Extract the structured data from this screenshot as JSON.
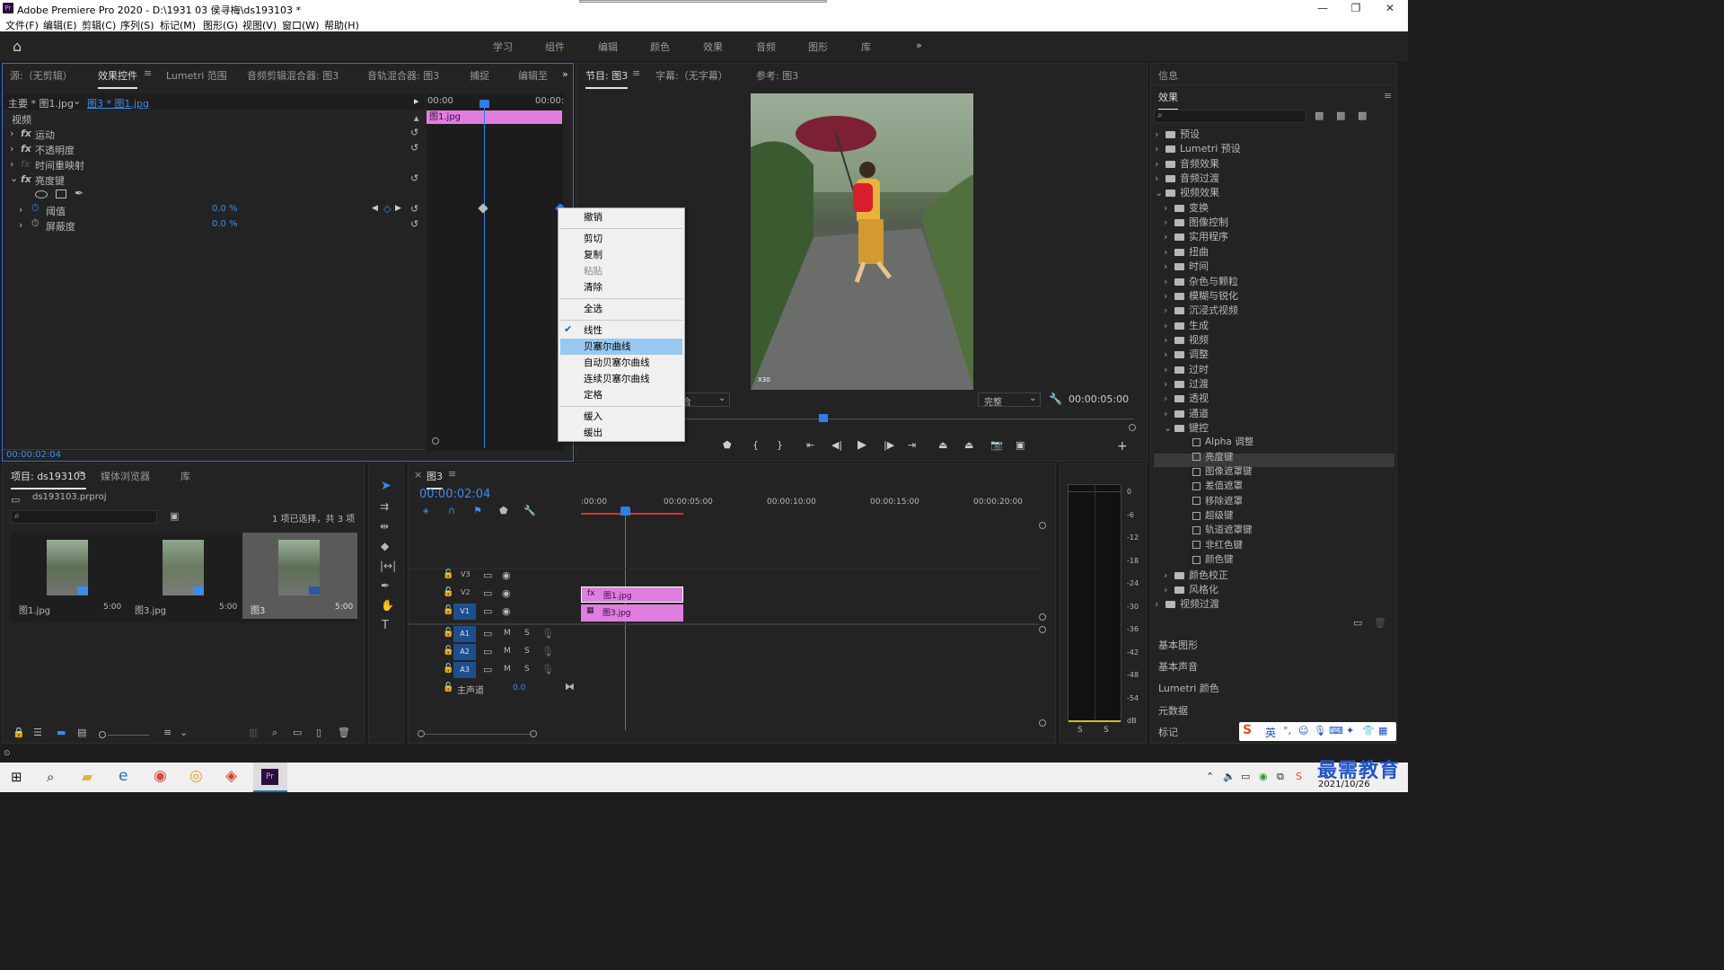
{
  "window": {
    "app_title": "Adobe Premiere Pro 2020 - D:\\1931 03 侯寻梅\\ds193103 *",
    "app_icon": "Pr"
  },
  "menu": [
    "文件(F)",
    "编辑(E)",
    "剪辑(C)",
    "序列(S)",
    "标记(M)",
    "图形(G)",
    "视图(V)",
    "窗口(W)",
    "帮助(H)"
  ],
  "workspaces": [
    "学习",
    "组件",
    "编辑",
    "颜色",
    "效果",
    "音频",
    "图形",
    "库"
  ],
  "source_panel": {
    "tabs": [
      "源:（无剪辑）",
      "效果控件",
      "Lumetri 范围",
      "音频剪辑混合器: 图3",
      "音轨混合器: 图3",
      "捕捉",
      "编辑至"
    ],
    "master": "主要 * 图1.jpg",
    "clip": "图3 * 图1.jpg",
    "section": "视频",
    "effects": [
      "运动",
      "不透明度",
      "时间重映射",
      "亮度键"
    ],
    "params": [
      {
        "name": "阈值",
        "value": "0.0 %"
      },
      {
        "name": "屏蔽度",
        "value": "0.0 %"
      }
    ],
    "mini_time_start": "00:00",
    "mini_time_end": "00:00:",
    "mini_clip": "图1.jpg",
    "timecode": "00:00:02:04"
  },
  "context_menu": {
    "items": [
      {
        "label": "撤销",
        "state": "normal"
      },
      {
        "label": "剪切",
        "state": "normal"
      },
      {
        "label": "复制",
        "state": "normal"
      },
      {
        "label": "粘贴",
        "state": "disabled"
      },
      {
        "label": "清除",
        "state": "normal"
      },
      {
        "label": "全选",
        "state": "normal"
      },
      {
        "label": "线性",
        "state": "checked"
      },
      {
        "label": "贝塞尔曲线",
        "state": "highlighted"
      },
      {
        "label": "自动贝塞尔曲线",
        "state": "normal"
      },
      {
        "label": "连续贝塞尔曲线",
        "state": "normal"
      },
      {
        "label": "定格",
        "state": "normal"
      },
      {
        "label": "缓入",
        "state": "normal"
      },
      {
        "label": "缓出",
        "state": "normal"
      }
    ]
  },
  "program_panel": {
    "tabs": [
      "节目: 图3",
      "字幕:（无字幕）",
      "参考: 图3"
    ],
    "fit_label": "合",
    "quality": "完整",
    "timecode": "00:00:05:00",
    "watermark": "X30"
  },
  "right_panel": {
    "info_label": "信息",
    "effects_label": "效果",
    "tree": [
      {
        "label": "预设",
        "type": "folder",
        "level": 0,
        "open": false
      },
      {
        "label": "Lumetri 预设",
        "type": "folder",
        "level": 0,
        "open": false
      },
      {
        "label": "音频效果",
        "type": "folder",
        "level": 0,
        "open": false
      },
      {
        "label": "音频过渡",
        "type": "folder",
        "level": 0,
        "open": false
      },
      {
        "label": "视频效果",
        "type": "folder",
        "level": 0,
        "open": true
      },
      {
        "label": "变换",
        "type": "folder",
        "level": 1,
        "open": false
      },
      {
        "label": "图像控制",
        "type": "folder",
        "level": 1,
        "open": false
      },
      {
        "label": "实用程序",
        "type": "folder",
        "level": 1,
        "open": false
      },
      {
        "label": "扭曲",
        "type": "folder",
        "level": 1,
        "open": false
      },
      {
        "label": "时间",
        "type": "folder",
        "level": 1,
        "open": false
      },
      {
        "label": "杂色与颗粒",
        "type": "folder",
        "level": 1,
        "open": false
      },
      {
        "label": "模糊与锐化",
        "type": "folder",
        "level": 1,
        "open": false
      },
      {
        "label": "沉浸式视频",
        "type": "folder",
        "level": 1,
        "open": false
      },
      {
        "label": "生成",
        "type": "folder",
        "level": 1,
        "open": false
      },
      {
        "label": "视频",
        "type": "folder",
        "level": 1,
        "open": false
      },
      {
        "label": "调整",
        "type": "folder",
        "level": 1,
        "open": false
      },
      {
        "label": "过时",
        "type": "folder",
        "level": 1,
        "open": false
      },
      {
        "label": "过渡",
        "type": "folder",
        "level": 1,
        "open": false
      },
      {
        "label": "透视",
        "type": "folder",
        "level": 1,
        "open": false
      },
      {
        "label": "通道",
        "type": "folder",
        "level": 1,
        "open": false
      },
      {
        "label": "键控",
        "type": "folder",
        "level": 1,
        "open": true
      },
      {
        "label": "Alpha 调整",
        "type": "preset",
        "level": 2
      },
      {
        "label": "亮度键",
        "type": "preset",
        "level": 2,
        "selected": true
      },
      {
        "label": "图像遮罩键",
        "type": "preset",
        "level": 2
      },
      {
        "label": "差值遮罩",
        "type": "preset",
        "level": 2
      },
      {
        "label": "移除遮罩",
        "type": "preset",
        "level": 2
      },
      {
        "label": "超级键",
        "type": "preset",
        "level": 2
      },
      {
        "label": "轨道遮罩键",
        "type": "preset",
        "level": 2
      },
      {
        "label": "非红色键",
        "type": "preset",
        "level": 2
      },
      {
        "label": "颜色键",
        "type": "preset",
        "level": 2
      },
      {
        "label": "颜色校正",
        "type": "folder",
        "level": 1,
        "open": false
      },
      {
        "label": "风格化",
        "type": "folder",
        "level": 1,
        "open": false
      },
      {
        "label": "视频过渡",
        "type": "folder",
        "level": 0,
        "open": false
      }
    ],
    "bottom_sections": [
      "基本图形",
      "基本声音",
      "Lumetri 颜色",
      "元数据",
      "标记"
    ]
  },
  "project_panel": {
    "tabs": [
      "项目: ds193103",
      "媒体浏览器",
      "库"
    ],
    "project_file": "ds193103.prproj",
    "selection_info": "1 项已选择，共 3 项",
    "items": [
      {
        "name": "图1.jpg",
        "duration": "5:00"
      },
      {
        "name": "图3.jpg",
        "duration": "5:00"
      },
      {
        "name": "图3",
        "duration": "5:00"
      }
    ]
  },
  "timeline": {
    "tab": "图3",
    "timecode": "00:00:02:04",
    "ruler": [
      ":00:00",
      "00:00:05:00",
      "00:00:10:00",
      "00:00:15:00",
      "00:00:20:00"
    ],
    "video_tracks": [
      "V3",
      "V2",
      "V1"
    ],
    "audio_tracks": [
      "A1",
      "A2",
      "A3"
    ],
    "master_label": "主声道",
    "master_value": "0.0",
    "clips": [
      {
        "track": "V2",
        "label": "图1.jpg"
      },
      {
        "track": "V1",
        "label": "图3.jpg"
      }
    ],
    "M": "M",
    "S": "S"
  },
  "meter": {
    "scale": [
      "0",
      "-6",
      "-12",
      "-18",
      "-24",
      "-30",
      "-36",
      "-42",
      "-48",
      "-54",
      "dB"
    ],
    "s_labels": [
      "S",
      "S"
    ]
  },
  "ime": {
    "lang": "英"
  },
  "taskbar": {
    "date": "2021/10/26"
  },
  "brand": {
    "watermark": "最需教育"
  },
  "colors": {
    "accent_blue": "#2e7fe8",
    "clip_pink": "#e07ee0",
    "menu_highlight": "#99c8f0",
    "panel_bg": "#232323"
  }
}
